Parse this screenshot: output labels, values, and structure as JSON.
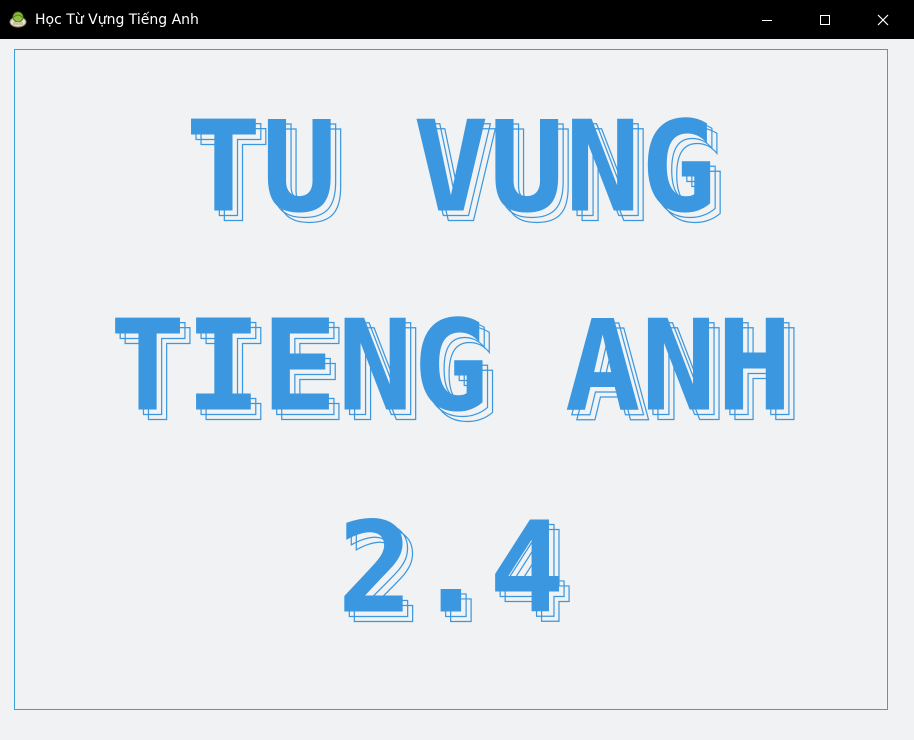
{
  "window": {
    "title": "Học Từ Vựng Tiếng Anh",
    "icon": "book-globe-icon",
    "controls": {
      "minimize": "minimize-icon",
      "maximize": "maximize-icon",
      "close": "close-icon"
    }
  },
  "banner": {
    "lines": [
      "TU VUNG",
      "TIENG ANH",
      "2.4"
    ],
    "color": "#3b97df"
  },
  "colors": {
    "titlebar": "#000000",
    "background": "#f1f2f3",
    "panel_border": "#3aa0d8"
  }
}
